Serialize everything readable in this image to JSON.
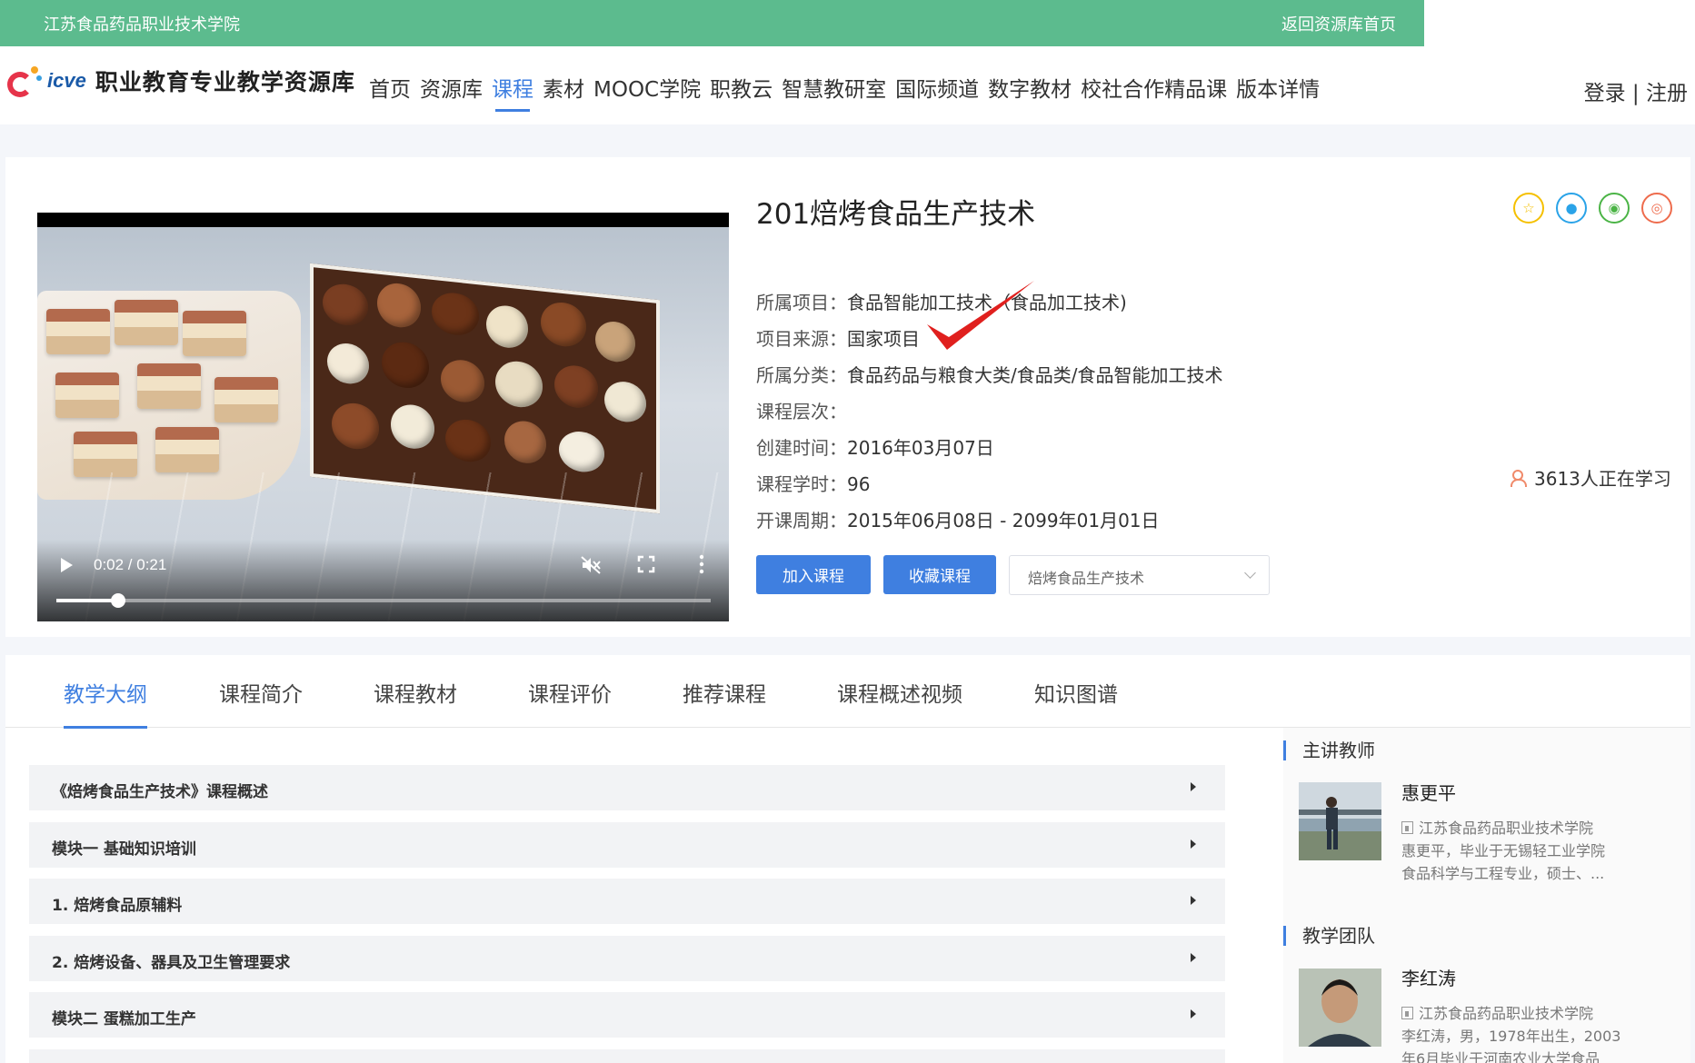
{
  "topbar": {
    "school": "江苏食品药品职业技术学院",
    "back": "返回资源库首页"
  },
  "header": {
    "logo_icve": "icve",
    "logo_title": "职业教育专业教学资源库",
    "nav": [
      "首页",
      "资源库",
      "课程",
      "素材",
      "MOOC学院",
      "职教云",
      "智慧教研室",
      "国际频道",
      "数字教材",
      "校社合作精品课",
      "版本详情"
    ],
    "active_nav": "课程",
    "login": "登录",
    "separator": " | ",
    "register": "注册"
  },
  "video": {
    "time": "0:02 / 0:21",
    "progress": 0.095
  },
  "course": {
    "title": "201焙烤食品生产技术",
    "info": [
      {
        "label": "所属项目：",
        "value": "食品智能加工技术（食品加工技术)"
      },
      {
        "label": "项目来源：",
        "value": "国家项目"
      },
      {
        "label": "所属分类：",
        "value": "食品药品与粮食大类/食品类/食品智能加工技术"
      },
      {
        "label": "课程层次：",
        "value": ""
      },
      {
        "label": "创建时间：",
        "value": "2016年03月07日"
      },
      {
        "label": "课程学时：",
        "value": "96"
      },
      {
        "label": "开课周期：",
        "value": "2015年06月08日 - 2099年01月01日"
      }
    ],
    "learners": "3613人正在学习",
    "join_button": "加入课程",
    "fav_button": "收藏课程",
    "select_value": "焙烤食品生产技术"
  },
  "share_icons": [
    {
      "name": "star-share-icon",
      "color": "#f5c000",
      "glyph": "☆"
    },
    {
      "name": "qq-share-icon",
      "color": "#2aa3e8",
      "glyph": "●"
    },
    {
      "name": "wechat-share-icon",
      "color": "#4bb446",
      "glyph": "◉"
    },
    {
      "name": "weibo-share-icon",
      "color": "#ee6c4d",
      "glyph": "◎"
    }
  ],
  "tabs": [
    "教学大纲",
    "课程简介",
    "课程教材",
    "课程评价",
    "推荐课程",
    "课程概述视频",
    "知识图谱"
  ],
  "syllabus": [
    "《焙烤食品生产技术》课程概述",
    "模块一 基础知识培训",
    "1. 焙烤食品原辅料",
    "2. 焙烤设备、器具及卫生管理要求",
    "模块二 蛋糕加工生产"
  ],
  "sidebar": {
    "lead_title": "主讲教师",
    "lead": {
      "name": "惠更平",
      "school": "江苏食品药品职业技术学院",
      "desc1": "惠更平，毕业于无锡轻工业学院",
      "desc2": "食品科学与工程专业，硕士、..."
    },
    "team_title": "教学团队",
    "team": {
      "name": "李红涛",
      "school": "江苏食品药品职业技术学院",
      "desc1": "李红涛，男，1978年出生，2003",
      "desc2": "年6月毕业于河南农业大学食品"
    }
  },
  "colors": {
    "green_bar": "#5cbb8e",
    "accent": "#3f7fe0",
    "check": "#e0201e"
  }
}
